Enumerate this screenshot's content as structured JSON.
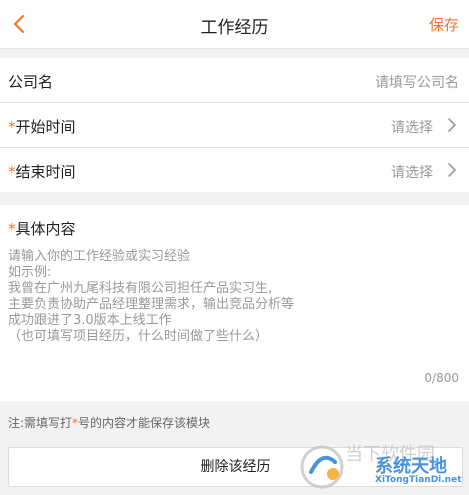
{
  "nav": {
    "title": "工作经历",
    "save_label": "保存"
  },
  "form": {
    "company": {
      "label": "公司名",
      "placeholder": "请填写公司名"
    },
    "start": {
      "required_mark": "*",
      "label": "开始时间",
      "value": "请选择"
    },
    "end": {
      "required_mark": "*",
      "label": "结束时间",
      "value": "请选择"
    }
  },
  "content": {
    "required_mark": "*",
    "label": "具体内容",
    "placeholder": "请输入你的工作经验或实习经验\n如示例:\n我曾在广州九尾科技有限公司担任产品实习生,\n主要负责协助产品经理整理需求，输出竞品分析等\n成功跟进了3.0版本上线工作\n（也可填写项目经历，什么时间做了些什么）",
    "counter": "0/800"
  },
  "note": {
    "prefix": "注:需填写打",
    "star": "*",
    "suffix": "号的内容才能保存该模块"
  },
  "delete_button": {
    "label": "删除该经历"
  },
  "watermark": {
    "grey_text": "当下软件园",
    "brand_text": "系统天地",
    "brand_sub": "XiTongTianDi.net"
  },
  "colors": {
    "accent": "#f5762a",
    "brand_blue": "#2a7fd6"
  },
  "icons": {
    "back": "chevron-left-icon",
    "chevron": "chevron-right-icon"
  }
}
